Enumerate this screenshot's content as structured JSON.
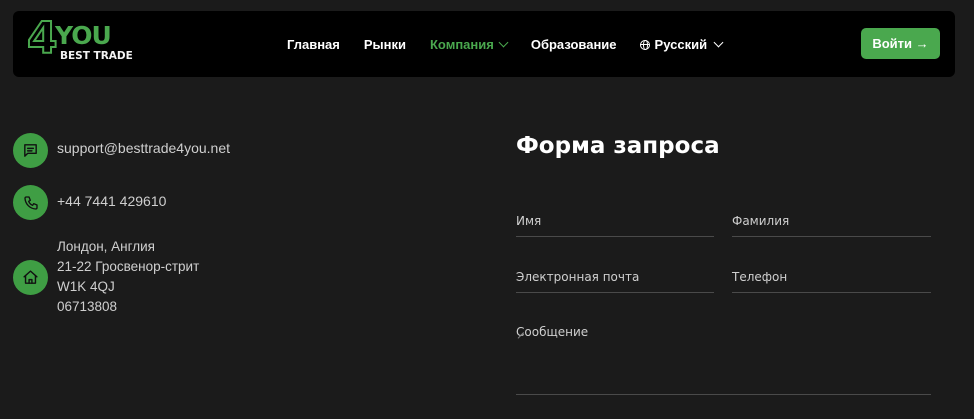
{
  "header": {
    "logo": {
      "mark": "4",
      "you": "YOU",
      "tagline": "BEST TRADE"
    },
    "nav": [
      {
        "label": "Главная"
      },
      {
        "label": "Рынки"
      },
      {
        "label": "Компания"
      },
      {
        "label": "Образование"
      },
      {
        "label": "Русский"
      }
    ],
    "login_label": "Войти →"
  },
  "contacts": {
    "email": "support@besttrade4you.net",
    "phone": "+44 7441 429610",
    "address": [
      "Лондон, Англия",
      "21-22 Гросвенор-стрит",
      "W1K 4QJ",
      "06713808"
    ]
  },
  "form": {
    "title": "Форма запроса",
    "first_name": "Имя",
    "last_name": "Фамилия",
    "email": "Электронная почта",
    "phone": "Телефон",
    "message": "Сообщение"
  },
  "colors": {
    "accent": "#4aa84e",
    "background": "#1b1b1b",
    "header": "#000000"
  }
}
